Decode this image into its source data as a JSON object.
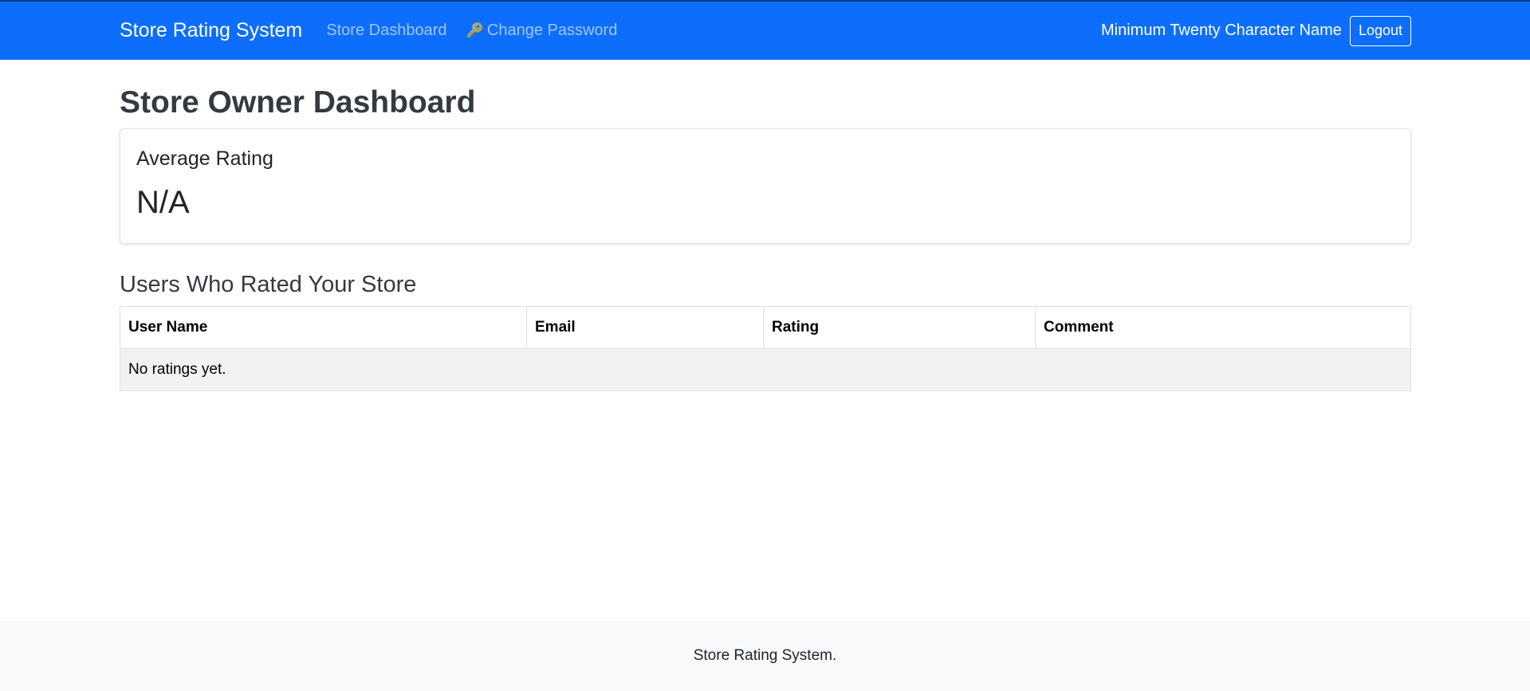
{
  "navbar": {
    "brand": "Store Rating System",
    "links": [
      {
        "label": "Store Dashboard"
      },
      {
        "label": "Change Password",
        "icon": "key-icon"
      }
    ],
    "user_name": "Minimum Twenty Character Name",
    "logout_label": "Logout",
    "background_color": "#0d6efd"
  },
  "main": {
    "title": "Store Owner Dashboard",
    "average_card": {
      "title": "Average Rating",
      "value": "N/A"
    },
    "ratings_section": {
      "title": "Users Who Rated Your Store",
      "columns": [
        "User Name",
        "Email",
        "Rating",
        "Comment"
      ],
      "empty_message": "No ratings yet."
    }
  },
  "footer": {
    "text": "Store Rating System."
  }
}
